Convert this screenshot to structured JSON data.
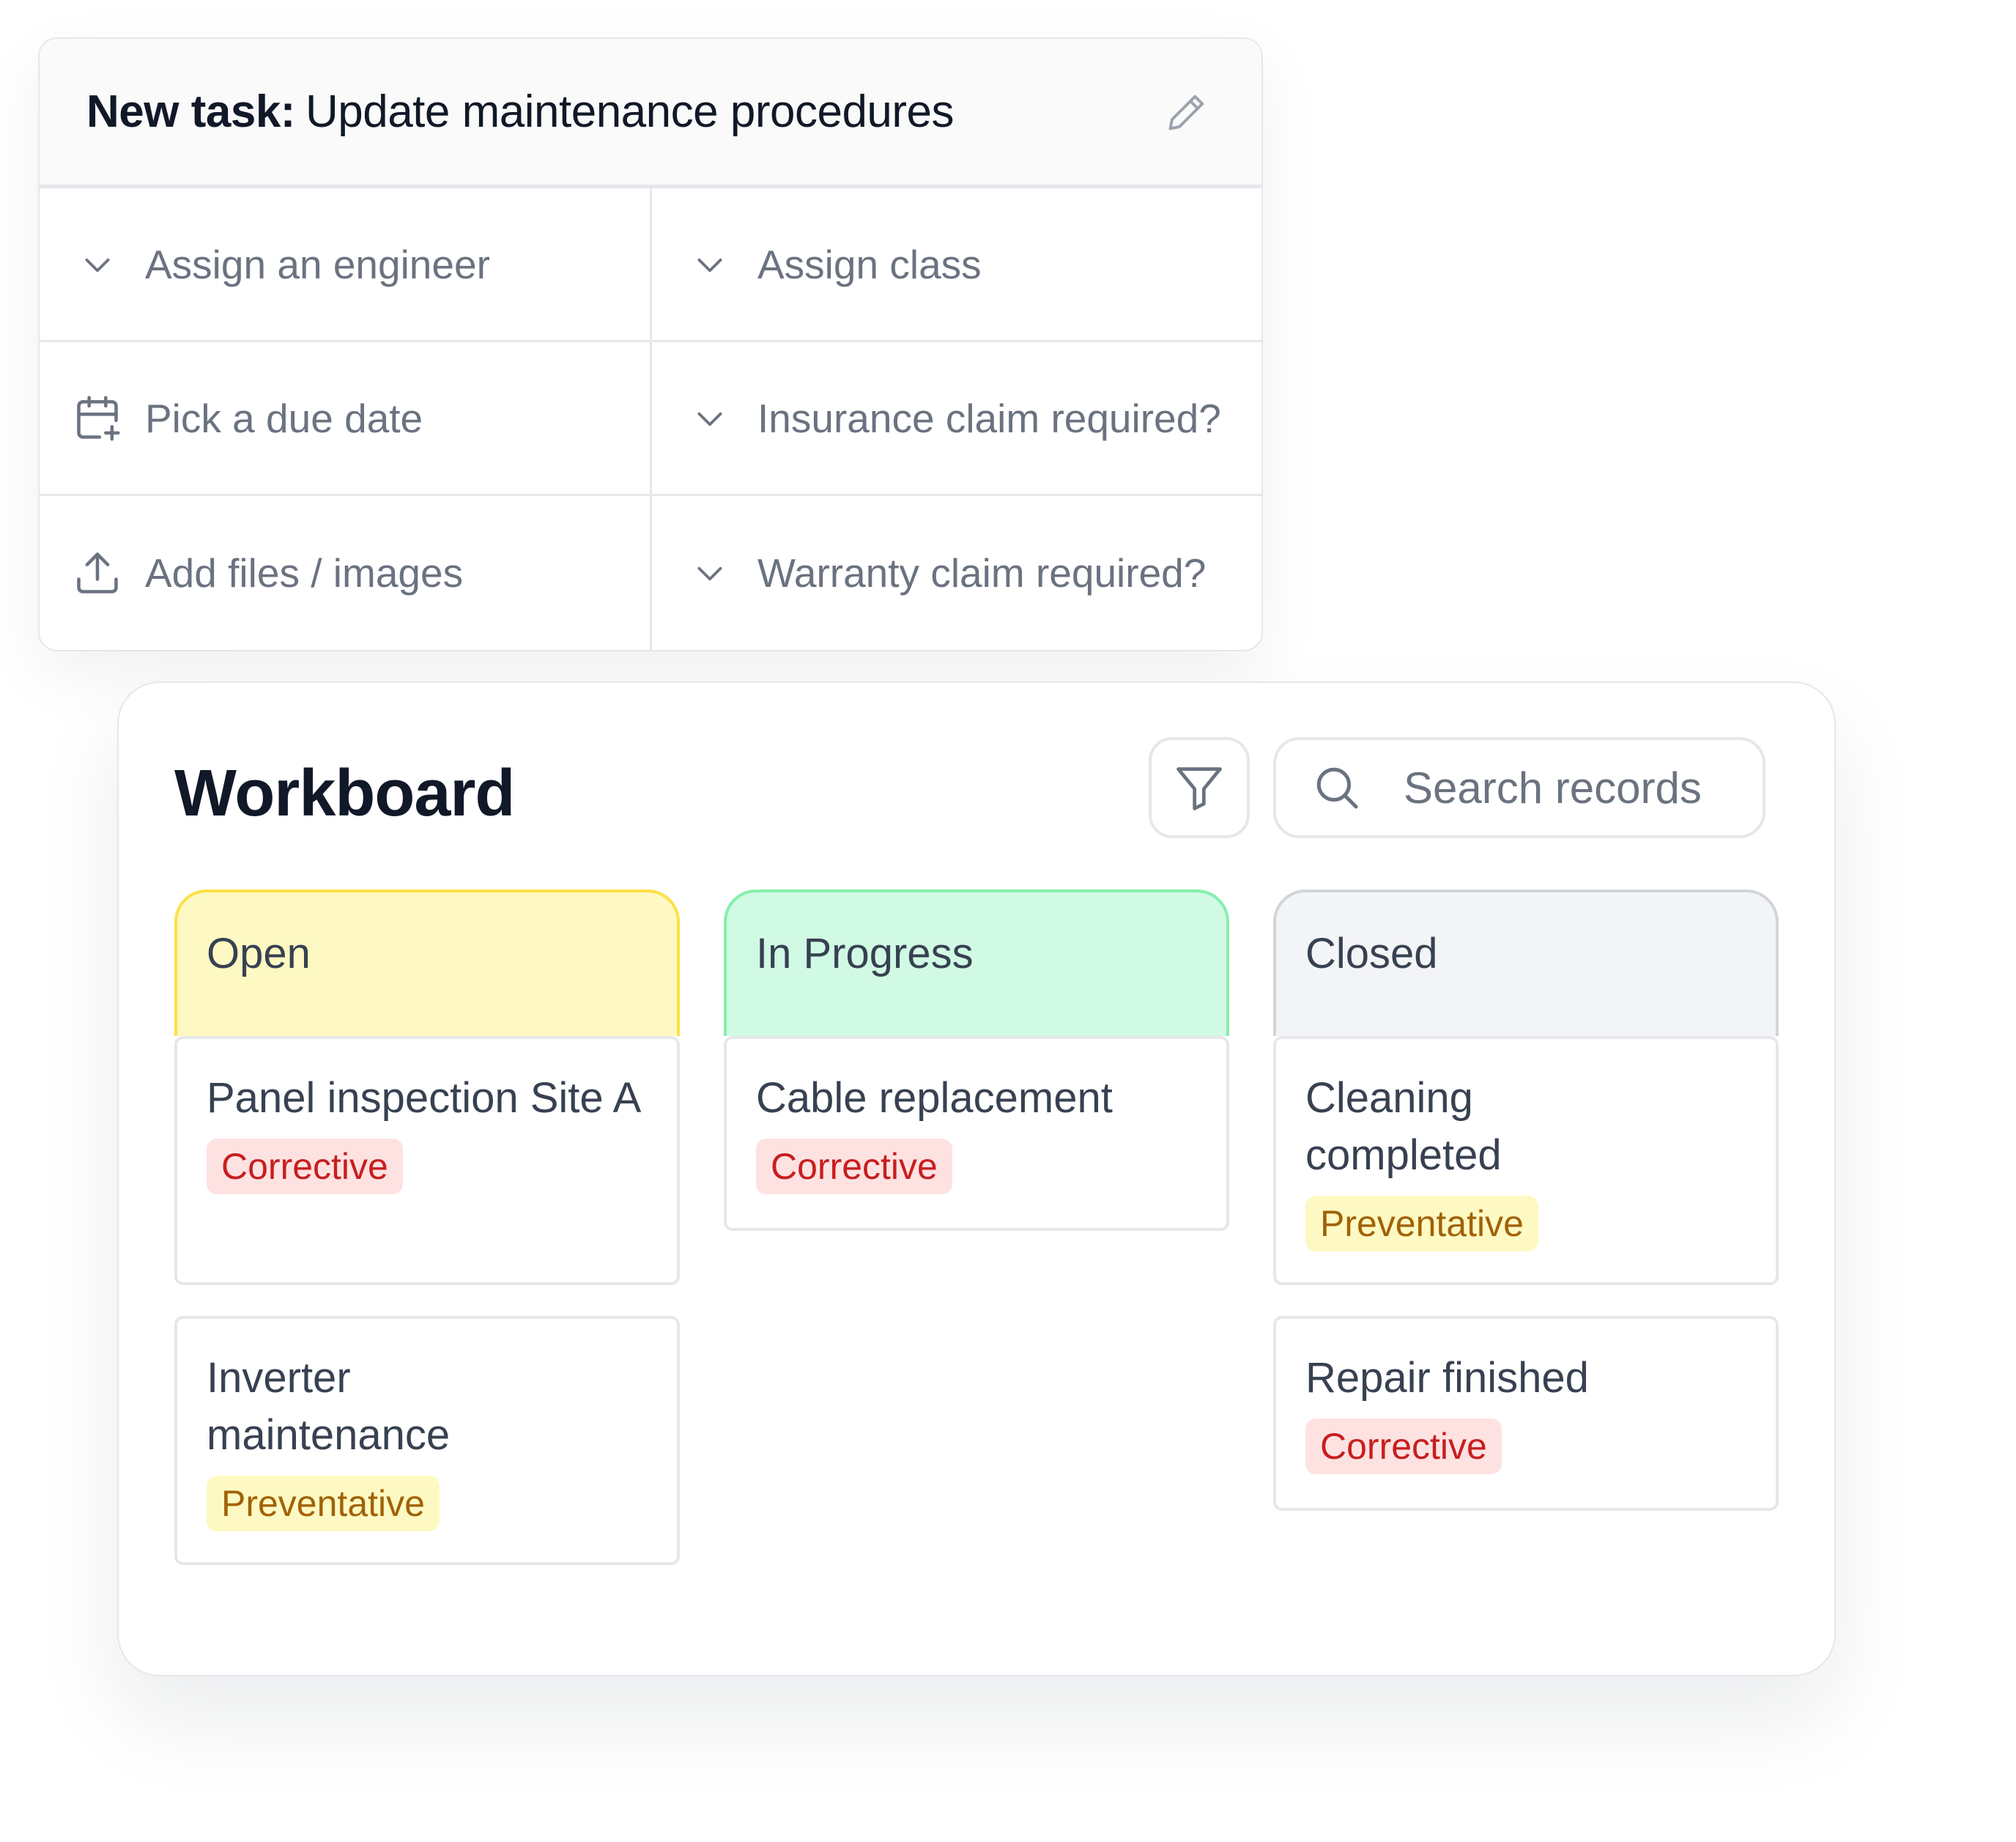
{
  "task": {
    "title_prefix": "New task:",
    "title": "Update maintenance procedures",
    "fields": [
      {
        "label": "Assign an engineer",
        "icon": "chevron-down-icon"
      },
      {
        "label": "Assign class",
        "icon": "chevron-down-icon"
      },
      {
        "label": "Pick a due date",
        "icon": "calendar-plus-icon"
      },
      {
        "label": "Insurance claim required?",
        "icon": "chevron-down-icon"
      },
      {
        "label": "Add files / images",
        "icon": "upload-icon"
      },
      {
        "label": "Warranty claim required?",
        "icon": "chevron-down-icon"
      }
    ]
  },
  "workboard": {
    "title": "Workboard",
    "search_placeholder": "Search records",
    "columns": [
      {
        "name": "Open",
        "color": "#fef9c3",
        "border": "#fde047",
        "cards": [
          {
            "title": "Panel inspection Site A",
            "tag": "Corrective"
          },
          {
            "title": "Inverter maintenance",
            "tag": "Preventative"
          }
        ]
      },
      {
        "name": "In Progress",
        "color": "#d1fae5",
        "border": "#86efac",
        "cards": [
          {
            "title": "Cable replacement",
            "tag": "Corrective"
          }
        ]
      },
      {
        "name": "Closed",
        "color": "#f3f4f6",
        "border": "#d1d5db",
        "cards": [
          {
            "title": "Cleaning completed",
            "tag": "Preventative"
          },
          {
            "title": "Repair finished",
            "tag": "Corrective"
          }
        ]
      }
    ]
  }
}
